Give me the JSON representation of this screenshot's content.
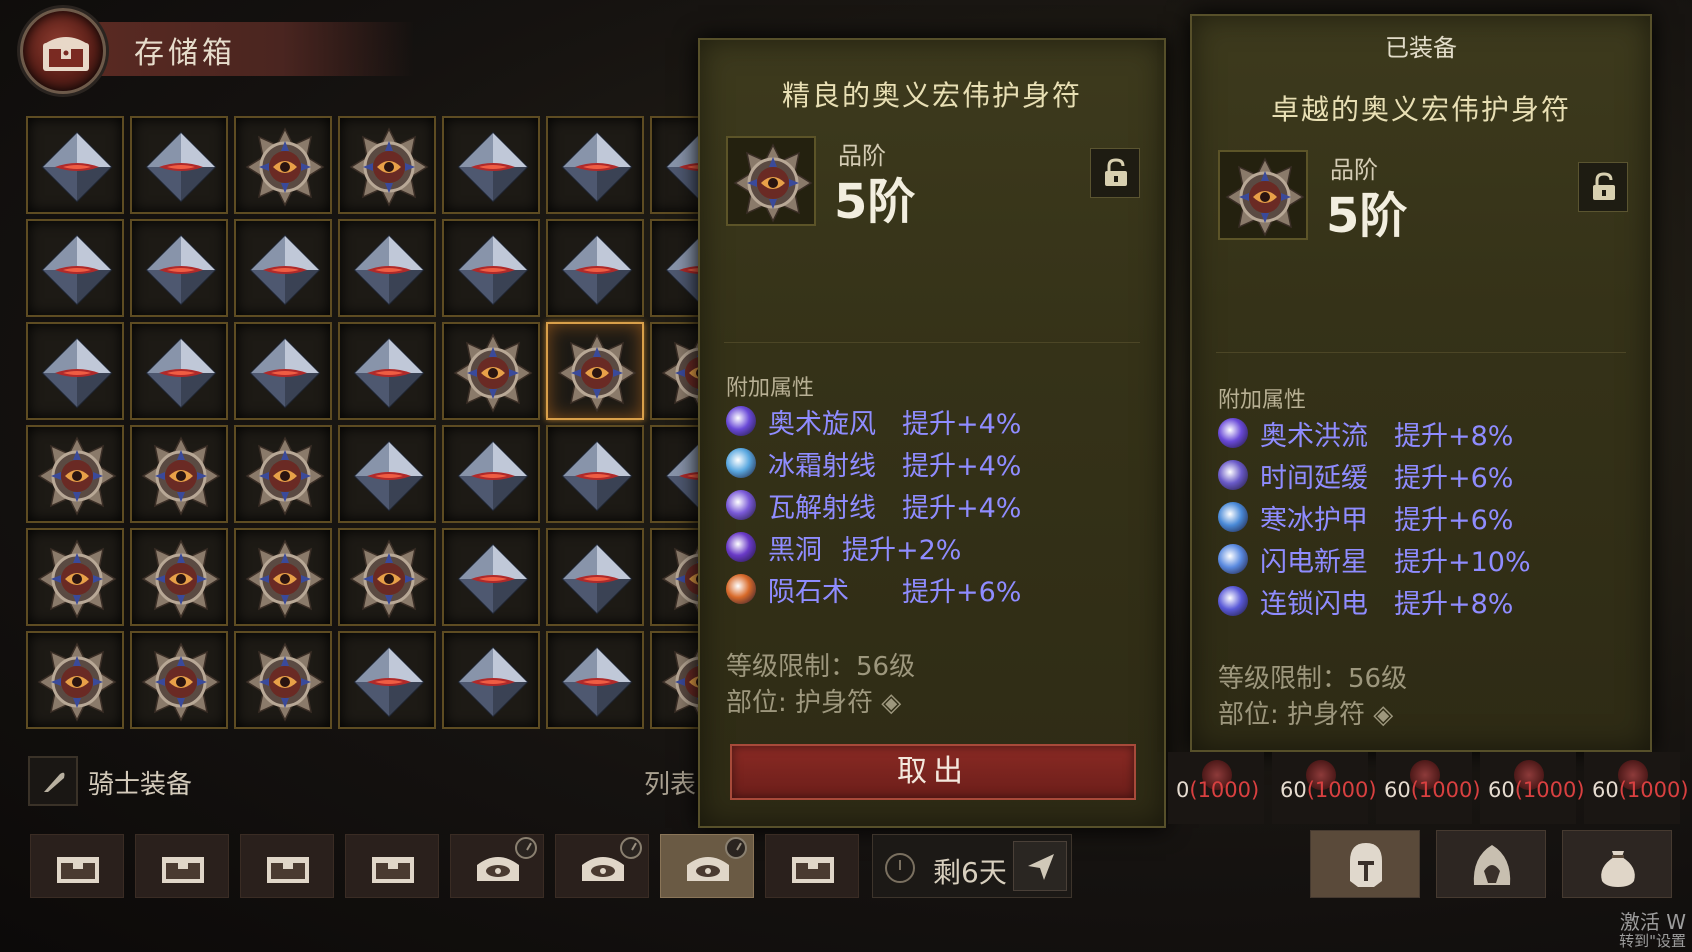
{
  "header": {
    "title": "存储箱"
  },
  "grid": {
    "rows": [
      [
        "crystal",
        "crystal",
        "medallion",
        "medallion",
        "crystal",
        "crystal",
        "crystal"
      ],
      [
        "crystal",
        "crystal",
        "crystal",
        "crystal",
        "crystal",
        "crystal",
        "crystal"
      ],
      [
        "crystal",
        "crystal",
        "crystal",
        "crystal",
        "medallion",
        "medallion",
        "medallion"
      ],
      [
        "medallion",
        "medallion",
        "medallion",
        "crystal",
        "crystal",
        "crystal",
        "crystal"
      ],
      [
        "medallion",
        "medallion",
        "medallion",
        "medallion",
        "crystal",
        "crystal",
        "medallion"
      ],
      [
        "medallion",
        "medallion",
        "medallion",
        "crystal",
        "crystal",
        "crystal",
        "medallion"
      ]
    ],
    "selected": [
      2,
      5
    ]
  },
  "footer": {
    "knight_label": "骑士装备",
    "list_label": "列表"
  },
  "left_panel": {
    "name": "精良的奥义宏伟护身符",
    "tier_label": "品阶",
    "tier_value": "5阶",
    "affix_header": "附加属性",
    "affixes": [
      {
        "name": "奥术旋风",
        "value": "提升+4%",
        "icon": "arcane-swirl-icon",
        "color": "#6a4ad8"
      },
      {
        "name": "冰霜射线",
        "value": "提升+4%",
        "icon": "frost-ray-icon",
        "color": "#5aa8e0"
      },
      {
        "name": "瓦解射线",
        "value": "提升+4%",
        "icon": "disintegrate-icon",
        "color": "#7a5ad8"
      },
      {
        "name": "黑洞",
        "value": "提升+2%",
        "icon": "black-hole-icon",
        "color": "#6a3ac8"
      },
      {
        "name": "陨石术",
        "value": "提升+6%",
        "icon": "meteor-icon",
        "color": "#d86a2a"
      }
    ],
    "level_req": "等级限制：56级",
    "slot": "部位: 护身符",
    "take_button": "取出"
  },
  "right_panel": {
    "equipped_label": "已装备",
    "name": "卓越的奥义宏伟护身符",
    "tier_label": "品阶",
    "tier_value": "5阶",
    "affix_header": "附加属性",
    "affixes": [
      {
        "name": "奥术洪流",
        "value": "提升+8%",
        "icon": "arcane-torrent-icon",
        "color": "#6a4ad8"
      },
      {
        "name": "时间延缓",
        "value": "提升+6%",
        "icon": "slow-time-icon",
        "color": "#6a5ac8"
      },
      {
        "name": "寒冰护甲",
        "value": "提升+6%",
        "icon": "frost-armor-icon",
        "color": "#4a8ad8"
      },
      {
        "name": "闪电新星",
        "value": "提升+10%",
        "icon": "lightning-nova-icon",
        "color": "#5a8ae0"
      },
      {
        "name": "连锁闪电",
        "value": "提升+8%",
        "icon": "chain-lightning-icon",
        "color": "#5a5ad8"
      }
    ],
    "level_req": "等级限制：56级",
    "slot": "部位: 护身符"
  },
  "slots": [
    {
      "a": "0",
      "b": "(1000)"
    },
    {
      "a": "60",
      "b": "(1000)"
    },
    {
      "a": "60",
      "b": "(1000)"
    },
    {
      "a": "60",
      "b": "(1000)"
    },
    {
      "a": "60",
      "b": "(1000)"
    }
  ],
  "bottom": {
    "tabs": [
      "chest-icon",
      "chest-icon",
      "chest-icon",
      "chest-icon",
      "ornate-chest-icon",
      "ornate-chest-icon",
      "ornate-chest-icon",
      "chest-icon"
    ],
    "active_tab": 6,
    "timer": "剩6天",
    "char_buttons": [
      "helmet-icon",
      "hood-icon",
      "sack-icon"
    ]
  },
  "watermark": {
    "line1": "激活 W",
    "line2": "转到\"设置"
  }
}
